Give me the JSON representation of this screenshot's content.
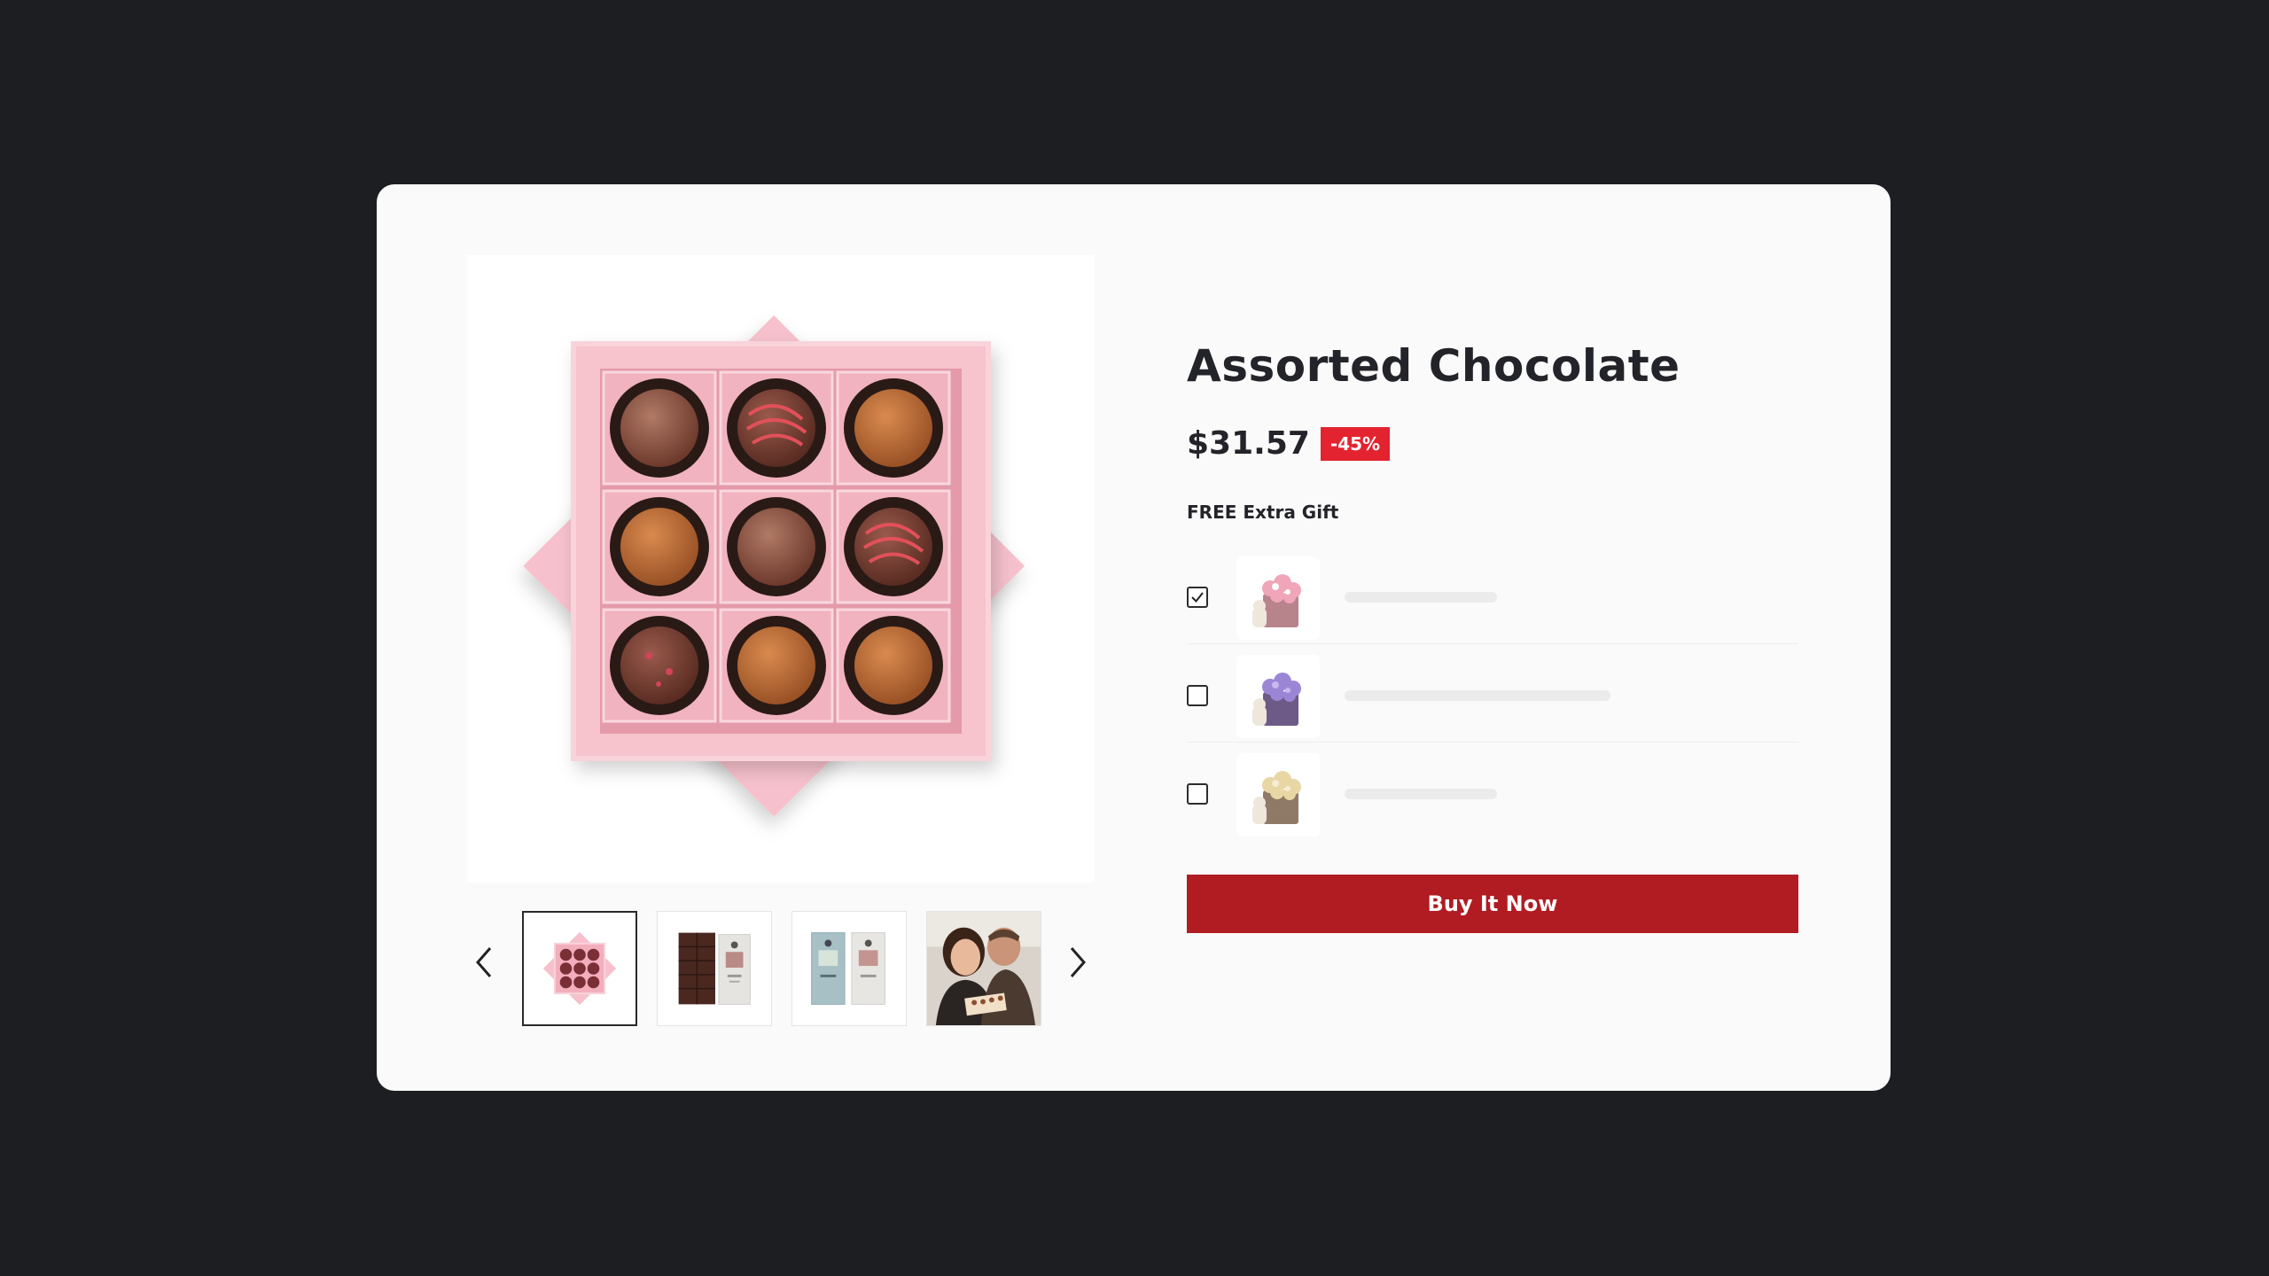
{
  "product": {
    "title": "Assorted Chocolate",
    "price": "$31.57",
    "discount_badge": "-45%"
  },
  "gallery": {
    "main_image": "pink-chocolate-box-image",
    "thumbnails": [
      {
        "name": "chocolate-box-thumbnail",
        "active": true
      },
      {
        "name": "dark-chocolate-bar-thumbnail",
        "active": false
      },
      {
        "name": "chocolate-bar-packages-thumbnail",
        "active": false
      },
      {
        "name": "couple-photo-thumbnail",
        "active": false
      }
    ],
    "prev_icon": "chevron-left-icon",
    "next_icon": "chevron-right-icon"
  },
  "gift": {
    "heading": "FREE Extra Gift",
    "options": [
      {
        "image": "pink-flower-box-image",
        "checked": true
      },
      {
        "image": "purple-flower-box-image",
        "checked": false
      },
      {
        "image": "cream-flower-box-image",
        "checked": false
      }
    ]
  },
  "actions": {
    "buy_label": "Buy It Now"
  },
  "colors": {
    "background": "#1d1e22",
    "card": "#fafafa",
    "accent": "#b01c22",
    "badge": "#e3232f",
    "box_pink": "#f4b6c2"
  }
}
